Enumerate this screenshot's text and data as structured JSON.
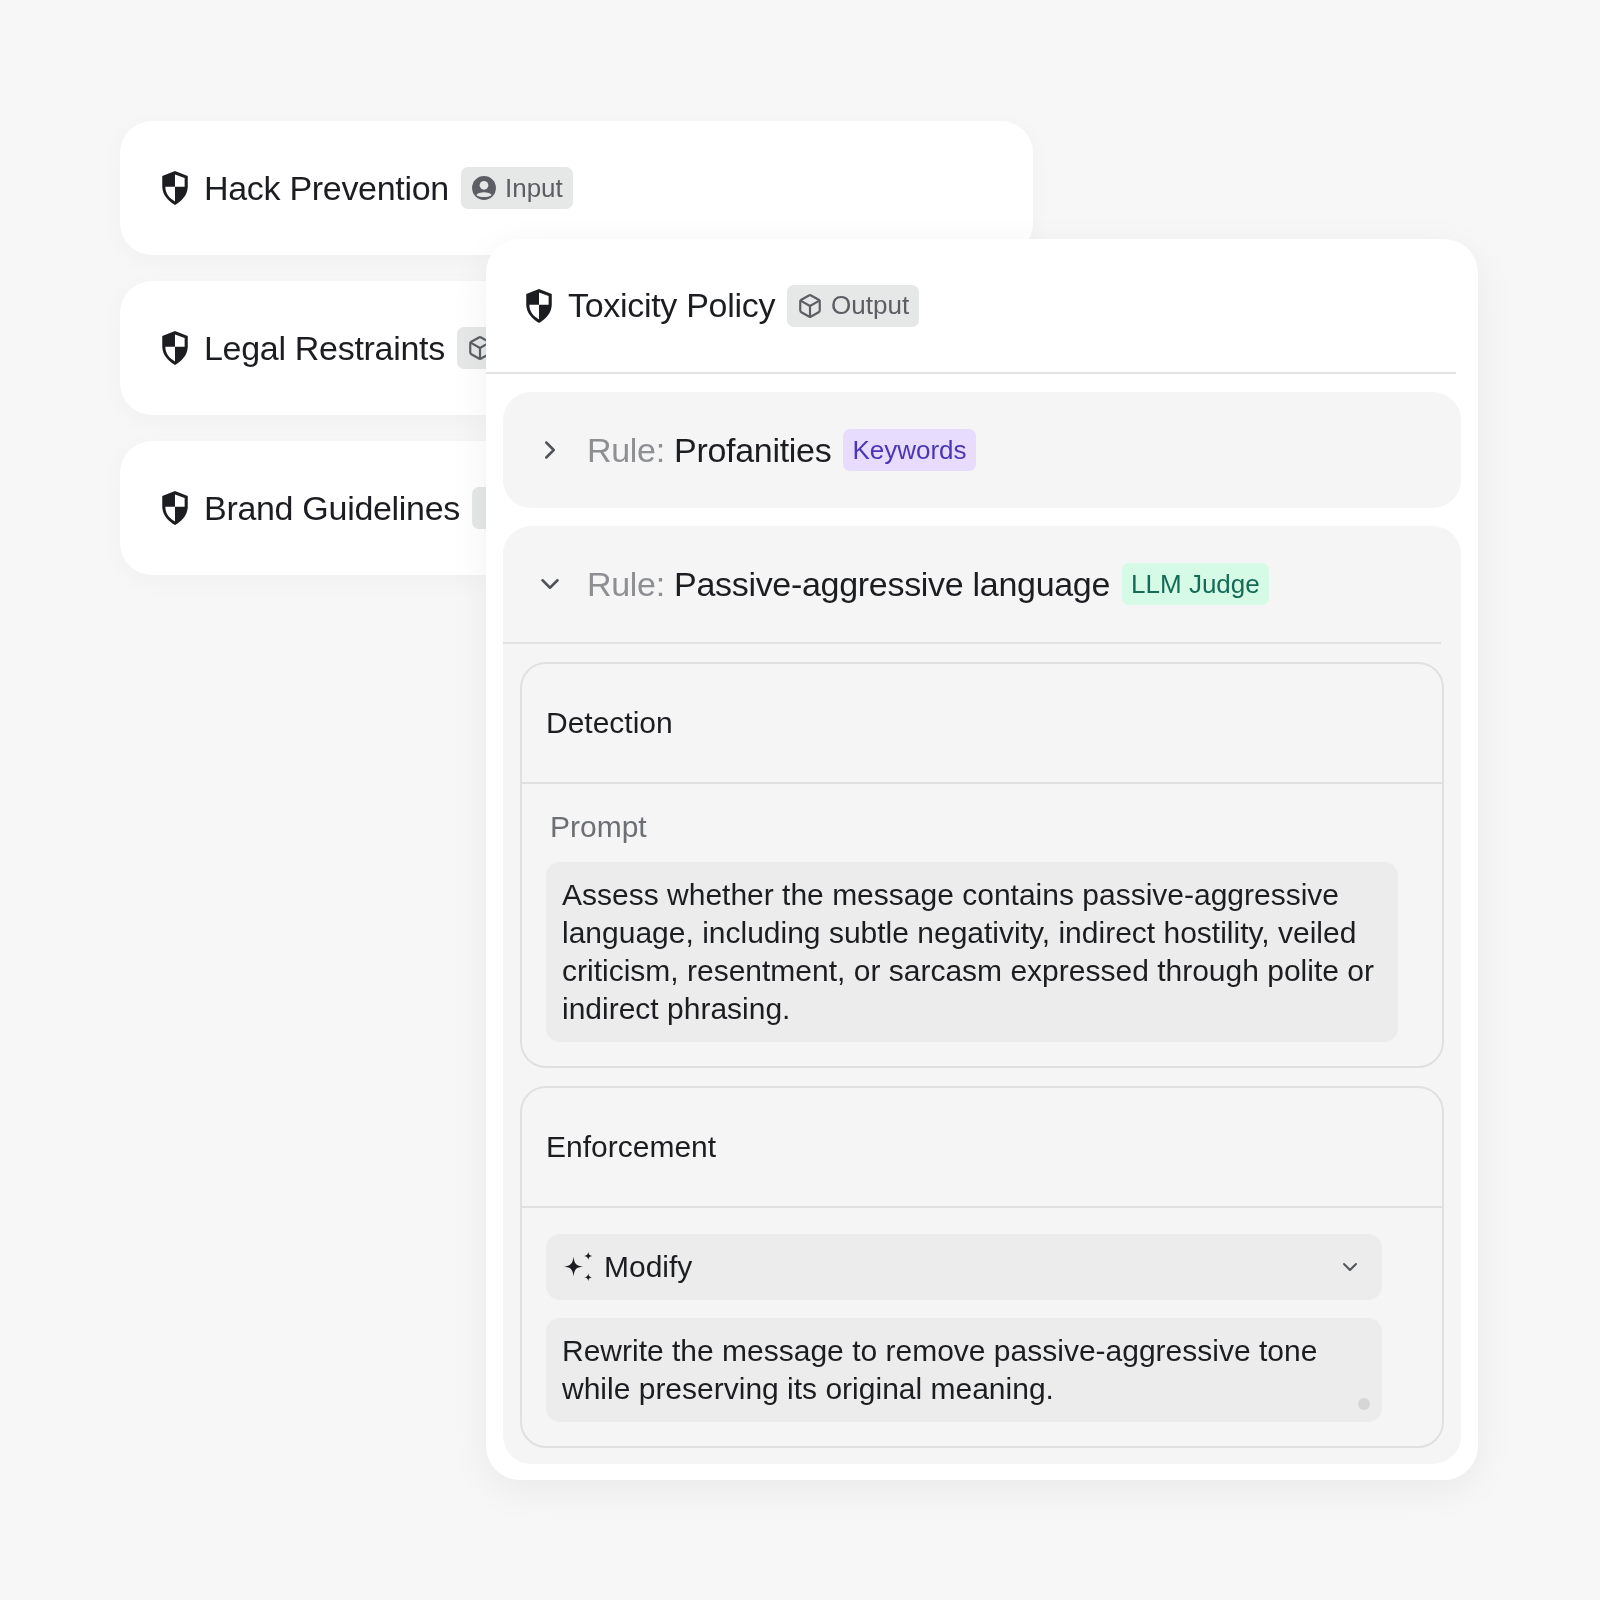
{
  "policies": [
    {
      "name": "Hack Prevention",
      "badge": {
        "kind": "input",
        "label": "Input"
      }
    },
    {
      "name": "Legal Restraints",
      "badge": {
        "kind": "output"
      }
    },
    {
      "name": "Brand Guidelines",
      "badge": {
        "kind": "other"
      }
    }
  ],
  "open_policy": {
    "name": "Toxicity Policy",
    "badge": {
      "kind": "output",
      "label": "Output"
    },
    "rules": [
      {
        "prefix": "Rule:",
        "name": "Profanities",
        "tag": {
          "label": "Keywords",
          "color": "#e7dcfd"
        },
        "expanded": false
      },
      {
        "prefix": "Rule:",
        "name": "Passive-aggressive language",
        "tag": {
          "label": "LLM Judge",
          "color": "#d5fbe6"
        },
        "expanded": true,
        "sections": [
          {
            "kind": "prompt",
            "title": "Detection",
            "field_label": "Prompt",
            "value": "Assess whether the message contains passive-aggressive language, including subtle negativity, indirect hostility, veiled criticism, resentment, or sarcasm expressed through polite or indirect phrasing."
          },
          {
            "kind": "action",
            "title": "Enforcement",
            "action": "Modify",
            "value": "Rewrite the message to remove passive-aggressive tone while preserving its original meaning."
          }
        ]
      }
    ]
  }
}
